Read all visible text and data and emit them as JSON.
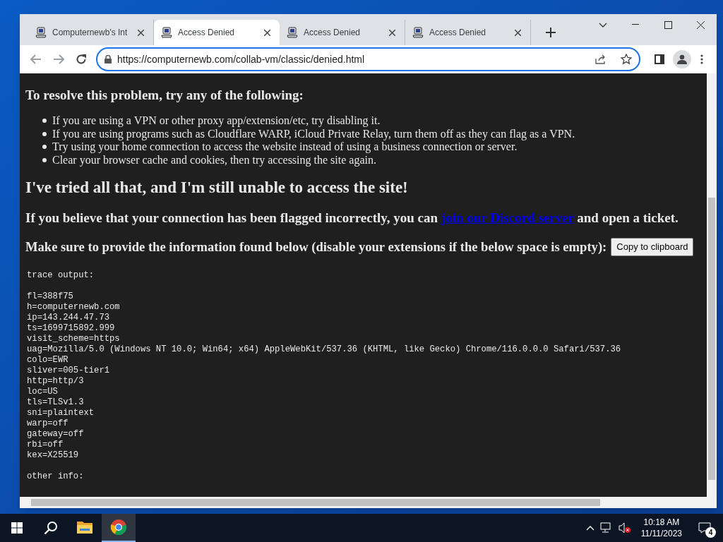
{
  "browser": {
    "tabs": [
      {
        "title": "Computernewb's Int",
        "selected": false
      },
      {
        "title": "Access Denied",
        "selected": true
      },
      {
        "title": "Access Denied",
        "selected": false
      },
      {
        "title": "Access Denied",
        "selected": false
      }
    ],
    "url": "https://computernewb.com/collab-vm/classic/denied.html"
  },
  "page": {
    "heading": "To resolve this problem, try any of the following:",
    "tips": [
      "If you are using a VPN or other proxy app/extension/etc, try disabling it.",
      "If you are using programs such as Cloudflare WARP, iCloud Private Relay, turn them off as they can flag as a VPN.",
      "Try using your home connection to access the website instead of using a business connection or server.",
      "Clear your browser cache and cookies, then try accessing the site again."
    ],
    "title": "I've tried all that, and I'm still unable to access the site!",
    "flagged_before": "If you believe that your connection has been flagged incorrectly, you can",
    "flagged_link": "join our Discord server",
    "flagged_after": "and open a ticket.",
    "provide": "Make sure to provide the information found below (disable your extensions if the below space is empty):",
    "copy_button": "Copy to clipboard",
    "trace_title": "trace output:",
    "trace": [
      "fl=388f75",
      "h=computernewb.com",
      "ip=143.244.47.73",
      "ts=1699715892.999",
      "visit_scheme=https",
      "uag=Mozilla/5.0 (Windows NT 10.0; Win64; x64) AppleWebKit/537.36 (KHTML, like Gecko) Chrome/116.0.0.0 Safari/537.36",
      "colo=EWR",
      "sliver=005-tier1",
      "http=http/3",
      "loc=US",
      "tls=TLSv1.3",
      "sni=plaintext",
      "warp=off",
      "gateway=off",
      "rbi=off",
      "kex=X25519"
    ],
    "other_title": "other info:"
  },
  "taskbar": {
    "apps": [
      {
        "kind": "explorer",
        "selected": false
      },
      {
        "kind": "chrome",
        "selected": true
      }
    ],
    "time": "10:18 AM",
    "date": "11/11/2023",
    "notifications": "4"
  }
}
